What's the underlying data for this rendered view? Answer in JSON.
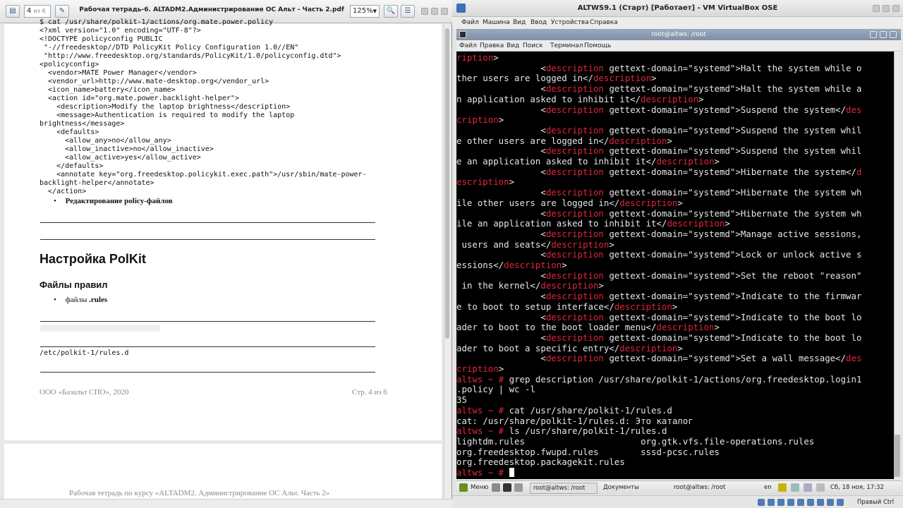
{
  "pdf": {
    "page_number": "4",
    "page_total": "из 6",
    "title": "Рабочая тетрадь-6. ALTADM2.Администрирование ОС Альт - Часть 2.pdf",
    "zoom": "125%",
    "code_lines": [
      "$ cat /usr/share/polkit-1/actions/org.mate.power.policy",
      "<?xml version=\"1.0\" encoding=\"UTF-8\"?>",
      "<!DOCTYPE policyconfig PUBLIC",
      " \"-//freedesktop//DTD PolicyKit Policy Configuration 1.0//EN\"",
      " \"http://www.freedesktop.org/standards/PolicyKit/1.0/policyconfig.dtd\">",
      "<policyconfig>",
      "  <vendor>MATE Power Manager</vendor>",
      "  <vendor_url>http://www.mate-desktop.org</vendor_url>",
      "  <icon_name>battery</icon_name>",
      "  <action id=\"org.mate.power.backlight-helper\">",
      "    <description>Modify the laptop brightness</description>",
      "    <message>Authentication is required to modify the laptop",
      "brightness</message>",
      "    <defaults>",
      "      <allow_any>no</allow_any>",
      "      <allow_inactive>no</allow_inactive>",
      "      <allow_active>yes</allow_active>",
      "    </defaults>",
      "    <annotate key=\"org.freedesktop.policykit.exec.path\">/usr/sbin/mate-power-",
      "backlight-helper</annotate>",
      "  </action>"
    ],
    "bullet_policy": "Редактирование policy-файлов",
    "heading": "Настройка PolKit",
    "subheading": "Файлы правил",
    "bullet_rules_prefix": "файлы ",
    "bullet_rules_bold": ".rules",
    "path": "/etc/polkit-1/rules.d",
    "footer_left": "ООО «Базальт СПО», 2020",
    "footer_right": "Стр. 4  из 6",
    "next_page_header": "Рабочая тетрадь по курсу «ALTADM2. Администрирование ОС Альт. Часть 2»"
  },
  "vbox": {
    "title": "ALTWS9.1 (Старт) [Работает] - VM VirtualBox OSE",
    "menu": [
      "Файл",
      "Машина",
      "Вид",
      "Ввод",
      "Устройства",
      "Справка"
    ]
  },
  "guest": {
    "window_title": "root@altws: /root",
    "term_menu": [
      "Файл",
      "Правка",
      "Вид",
      "Поиск",
      "Терминал",
      "Помощь"
    ],
    "terminal_lines": [
      [
        {
          "t": "ription",
          "c": "tag"
        },
        {
          "t": ">"
        }
      ],
      [
        {
          "t": "                <"
        },
        {
          "t": "description",
          "c": "tag"
        },
        {
          "t": " gettext-domain=\"systemd\">Halt the system while o"
        }
      ],
      [
        {
          "t": "ther users are logged in</"
        },
        {
          "t": "description",
          "c": "tag"
        },
        {
          "t": ">"
        }
      ],
      [
        {
          "t": "                <"
        },
        {
          "t": "description",
          "c": "tag"
        },
        {
          "t": " gettext-domain=\"systemd\">Halt the system while a"
        }
      ],
      [
        {
          "t": "n application asked to inhibit it</"
        },
        {
          "t": "description",
          "c": "tag"
        },
        {
          "t": ">"
        }
      ],
      [
        {
          "t": "                <"
        },
        {
          "t": "description",
          "c": "tag"
        },
        {
          "t": " gettext-domain=\"systemd\">Suspend the system</"
        },
        {
          "t": "des",
          "c": "tag"
        }
      ],
      [
        {
          "t": "cription",
          "c": "tag"
        },
        {
          "t": ">"
        }
      ],
      [
        {
          "t": "                <"
        },
        {
          "t": "description",
          "c": "tag"
        },
        {
          "t": " gettext-domain=\"systemd\">Suspend the system whil"
        }
      ],
      [
        {
          "t": "e other users are logged in</"
        },
        {
          "t": "description",
          "c": "tag"
        },
        {
          "t": ">"
        }
      ],
      [
        {
          "t": "                <"
        },
        {
          "t": "description",
          "c": "tag"
        },
        {
          "t": " gettext-domain=\"systemd\">Suspend the system whil"
        }
      ],
      [
        {
          "t": "e an application asked to inhibit it</"
        },
        {
          "t": "description",
          "c": "tag"
        },
        {
          "t": ">"
        }
      ],
      [
        {
          "t": "                <"
        },
        {
          "t": "description",
          "c": "tag"
        },
        {
          "t": " gettext-domain=\"systemd\">Hibernate the system</"
        },
        {
          "t": "d",
          "c": "tag"
        }
      ],
      [
        {
          "t": "escription",
          "c": "tag"
        },
        {
          "t": ">"
        }
      ],
      [
        {
          "t": "                <"
        },
        {
          "t": "description",
          "c": "tag"
        },
        {
          "t": " gettext-domain=\"systemd\">Hibernate the system wh"
        }
      ],
      [
        {
          "t": "ile other users are logged in</"
        },
        {
          "t": "description",
          "c": "tag"
        },
        {
          "t": ">"
        }
      ],
      [
        {
          "t": "                <"
        },
        {
          "t": "description",
          "c": "tag"
        },
        {
          "t": " gettext-domain=\"systemd\">Hibernate the system wh"
        }
      ],
      [
        {
          "t": "ile an application asked to inhibit it</"
        },
        {
          "t": "description",
          "c": "tag"
        },
        {
          "t": ">"
        }
      ],
      [
        {
          "t": "                <"
        },
        {
          "t": "description",
          "c": "tag"
        },
        {
          "t": " gettext-domain=\"systemd\">Manage active sessions,"
        }
      ],
      [
        {
          "t": " users and seats</"
        },
        {
          "t": "description",
          "c": "tag"
        },
        {
          "t": ">"
        }
      ],
      [
        {
          "t": "                <"
        },
        {
          "t": "description",
          "c": "tag"
        },
        {
          "t": " gettext-domain=\"systemd\">Lock or unlock active s"
        }
      ],
      [
        {
          "t": "essions</"
        },
        {
          "t": "description",
          "c": "tag"
        },
        {
          "t": ">"
        }
      ],
      [
        {
          "t": "                <"
        },
        {
          "t": "description",
          "c": "tag"
        },
        {
          "t": " gettext-domain=\"systemd\">Set the reboot \"reason\""
        }
      ],
      [
        {
          "t": " in the kernel</"
        },
        {
          "t": "description",
          "c": "tag"
        },
        {
          "t": ">"
        }
      ],
      [
        {
          "t": "                <"
        },
        {
          "t": "description",
          "c": "tag"
        },
        {
          "t": " gettext-domain=\"systemd\">Indicate to the firmwar"
        }
      ],
      [
        {
          "t": "e to boot to setup interface</"
        },
        {
          "t": "description",
          "c": "tag"
        },
        {
          "t": ">"
        }
      ],
      [
        {
          "t": "                <"
        },
        {
          "t": "description",
          "c": "tag"
        },
        {
          "t": " gettext-domain=\"systemd\">Indicate to the boot lo"
        }
      ],
      [
        {
          "t": "ader to boot to the boot loader menu</"
        },
        {
          "t": "description",
          "c": "tag"
        },
        {
          "t": ">"
        }
      ],
      [
        {
          "t": "                <"
        },
        {
          "t": "description",
          "c": "tag"
        },
        {
          "t": " gettext-domain=\"systemd\">Indicate to the boot lo"
        }
      ],
      [
        {
          "t": "ader to boot a specific entry</"
        },
        {
          "t": "description",
          "c": "tag"
        },
        {
          "t": ">"
        }
      ],
      [
        {
          "t": "                <"
        },
        {
          "t": "description",
          "c": "tag"
        },
        {
          "t": " gettext-domain=\"systemd\">Set a wall message</"
        },
        {
          "t": "des",
          "c": "tag"
        }
      ],
      [
        {
          "t": "cription",
          "c": "tag"
        },
        {
          "t": ">"
        }
      ],
      [
        {
          "t": "altws ~ # ",
          "c": "prompt"
        },
        {
          "t": "grep description /usr/share/polkit-1/actions/org.freedesktop.login1"
        }
      ],
      [
        {
          "t": ".policy | wc -l"
        }
      ],
      [
        {
          "t": "35"
        }
      ],
      [
        {
          "t": "altws ~ # ",
          "c": "prompt"
        },
        {
          "t": "cat /usr/share/polkit-1/rules.d"
        }
      ],
      [
        {
          "t": "cat: /usr/share/polkit-1/rules.d: Это каталог"
        }
      ],
      [
        {
          "t": "altws ~ # ",
          "c": "prompt"
        },
        {
          "t": "ls /usr/share/polkit-1/rules.d"
        }
      ],
      [
        {
          "t": "lightdm.rules                      org.gtk.vfs.file-operations.rules"
        }
      ],
      [
        {
          "t": "org.freedesktop.fwupd.rules        sssd-pcsc.rules"
        }
      ],
      [
        {
          "t": "org.freedesktop.packagekit.rules"
        }
      ],
      [
        {
          "t": "altws ~ # ",
          "c": "prompt"
        }
      ]
    ],
    "taskbar": {
      "menu_label": "Меню",
      "task1": "root@altws: /root",
      "task2": "Документы",
      "task3": "root@altws: /root",
      "lang": "en",
      "clock": "Сб, 18 ноя, 17:32"
    }
  },
  "host_status": {
    "hostkey": "Правый Ctrl"
  },
  "colors": {
    "tag_red": "#e0263a",
    "terminal_bg": "#000000",
    "terminal_fg": "#e6e6e6"
  }
}
